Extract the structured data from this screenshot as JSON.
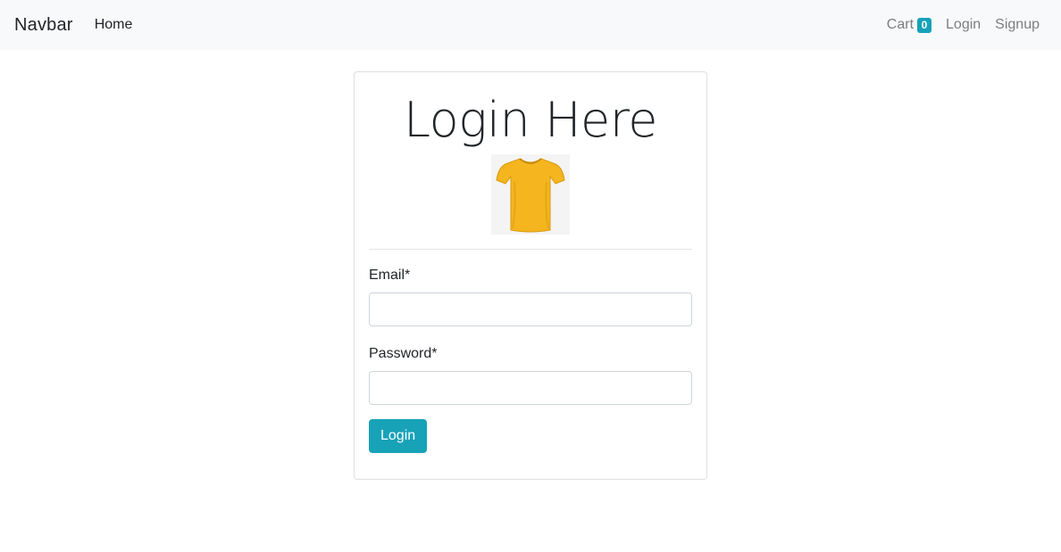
{
  "navbar": {
    "brand": "Navbar",
    "home": "Home",
    "cart_label": "Cart",
    "cart_count": "0",
    "login": "Login",
    "signup": "Signup"
  },
  "card": {
    "title": "Login Here",
    "logo_icon": "tshirt-icon",
    "email_label": "Email*",
    "email_value": "",
    "password_label": "Password*",
    "password_value": "",
    "submit_label": "Login"
  },
  "colors": {
    "accent": "#17a2b8",
    "navbar_bg": "#f8f9fa",
    "tshirt": "#f4b51f"
  }
}
